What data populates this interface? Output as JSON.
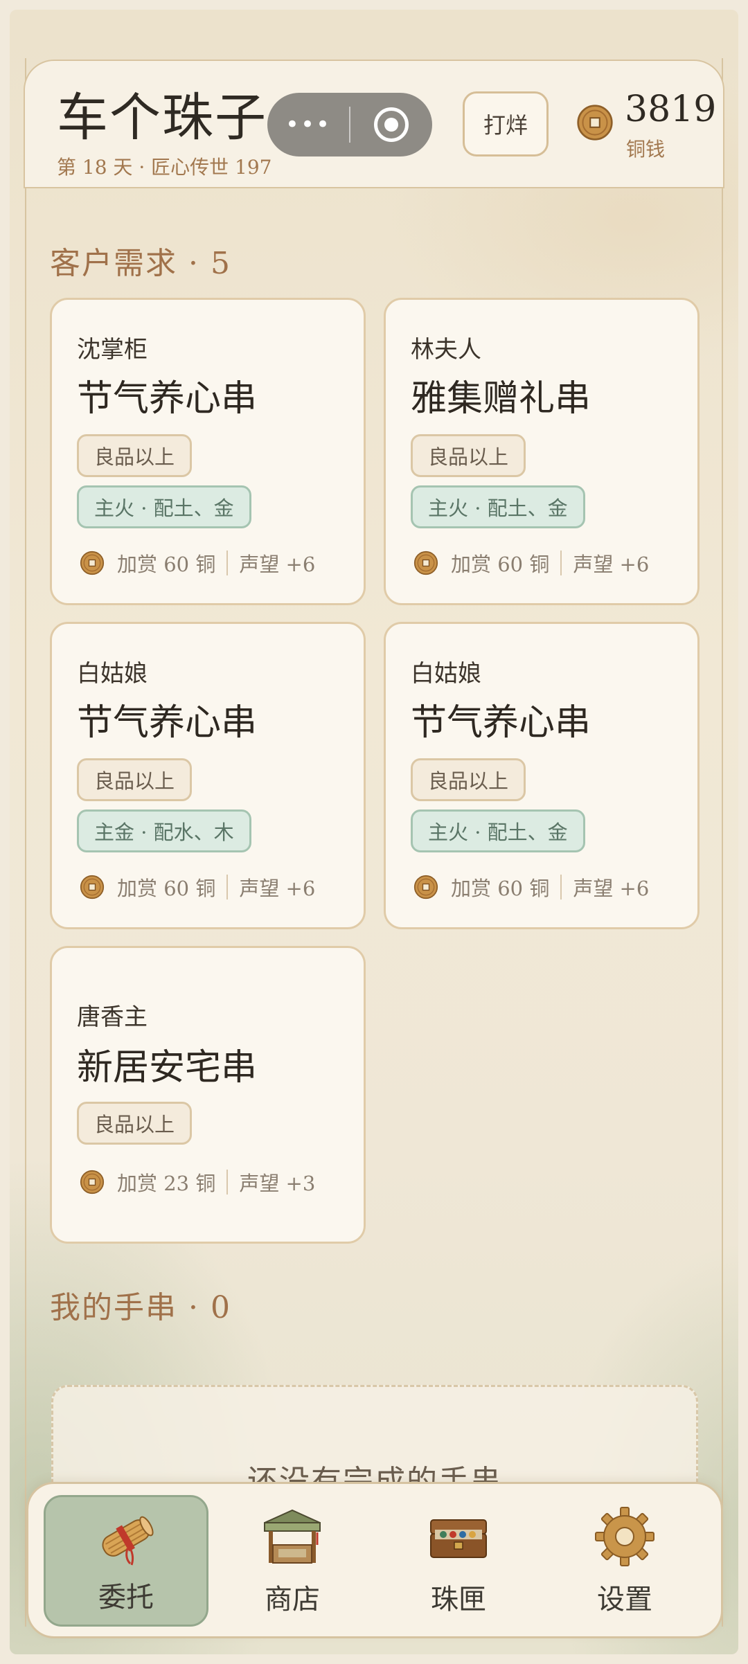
{
  "header": {
    "title": "车个珠子",
    "subtitle": "第 18 天 · 匠心传世 197",
    "forge_button": "打烊",
    "money": "3819",
    "money_label": "铜钱"
  },
  "requests_section": {
    "title": "客户需求 · 5"
  },
  "requests": [
    {
      "customer": "沈掌柜",
      "item": "节气养心串",
      "grade": "良品以上",
      "element": "主火 · 配土、金",
      "bonus": "加赏 60 铜",
      "reputation": "声望 +6"
    },
    {
      "customer": "林夫人",
      "item": "雅集赠礼串",
      "grade": "良品以上",
      "element": "主火 · 配土、金",
      "bonus": "加赏 60 铜",
      "reputation": "声望 +6"
    },
    {
      "customer": "白姑娘",
      "item": "节气养心串",
      "grade": "良品以上",
      "element": "主金 · 配水、木",
      "bonus": "加赏 60 铜",
      "reputation": "声望 +6"
    },
    {
      "customer": "白姑娘",
      "item": "节气养心串",
      "grade": "良品以上",
      "element": "主火 · 配土、金",
      "bonus": "加赏 60 铜",
      "reputation": "声望 +6"
    },
    {
      "customer": "唐香主",
      "item": "新居安宅串",
      "grade": "良品以上",
      "bonus": "加赏 23 铜",
      "reputation": "声望 +3"
    }
  ],
  "bracelets_section": {
    "title": "我的手串 · 0",
    "empty_text": "还没有完成的手串"
  },
  "tabbar": {
    "tabs": [
      {
        "label": "委托",
        "icon": "scroll-icon",
        "active": true
      },
      {
        "label": "商店",
        "icon": "shop-stall-icon",
        "active": false
      },
      {
        "label": "珠匣",
        "icon": "bead-chest-icon",
        "active": false
      },
      {
        "label": "设置",
        "icon": "gear-icon",
        "active": false
      }
    ]
  },
  "colors": {
    "accent_brown": "#a0714a",
    "active_tab_green": "#b6c4ab",
    "element_tag_green": "#dcebe2",
    "coin_gold": "#c9954a"
  }
}
